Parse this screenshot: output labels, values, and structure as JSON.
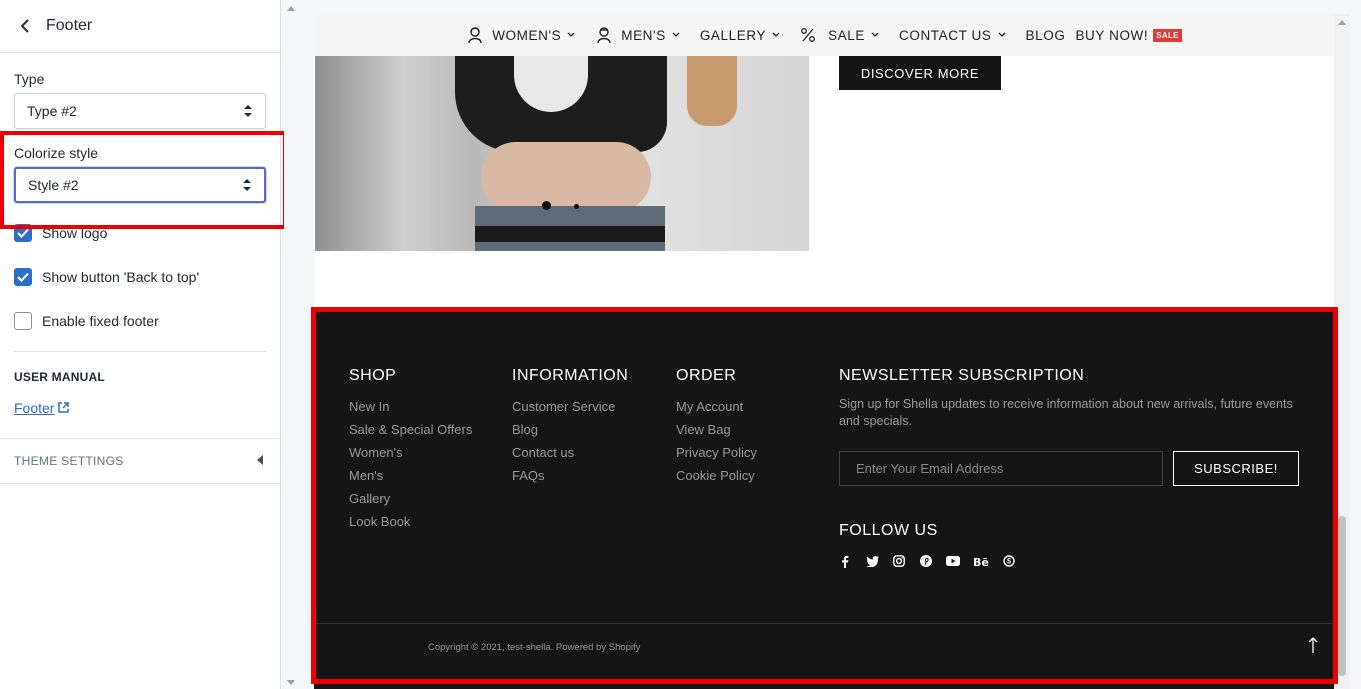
{
  "sidebar": {
    "title": "Footer",
    "type_label": "Type",
    "type_value": "Type #2",
    "colorize_label": "Colorize style",
    "colorize_value": "Style #2",
    "checkboxes": [
      {
        "label": "Show logo",
        "checked": true
      },
      {
        "label": "Show button 'Back to top'",
        "checked": true
      },
      {
        "label": "Enable fixed footer",
        "checked": false
      }
    ],
    "manual_heading": "USER MANUAL",
    "manual_link": "Footer",
    "theme_settings": "THEME SETTINGS"
  },
  "nav": {
    "items": [
      "WOMEN'S",
      "MEN'S",
      "GALLERY",
      "SALE",
      "CONTACT US",
      "BLOG",
      "BUY NOW!"
    ],
    "sale_badge": "SALE"
  },
  "hero": {
    "discover_label": "DISCOVER MORE"
  },
  "footer": {
    "shop": {
      "title": "SHOP",
      "links": [
        "New In",
        "Sale & Special Offers",
        "Women's",
        "Men's",
        "Gallery",
        "Look Book"
      ]
    },
    "information": {
      "title": "INFORMATION",
      "links": [
        "Customer Service",
        "Blog",
        "Contact us",
        "FAQs"
      ]
    },
    "order": {
      "title": "ORDER",
      "links": [
        "My Account",
        "View Bag",
        "Privacy Policy",
        "Cookie Policy"
      ]
    },
    "newsletter": {
      "title": "NEWSLETTER SUBSCRIPTION",
      "text": "Sign up for Shella updates to receive information about new arrivals, future events and specials.",
      "email_placeholder": "Enter Your Email Address",
      "subscribe_label": "SUBSCRIBE!"
    },
    "follow_title": "FOLLOW US",
    "social_icons": [
      "facebook-icon",
      "twitter-icon",
      "instagram-icon",
      "pinterest-icon",
      "youtube-icon",
      "behance-icon",
      "skype-icon"
    ],
    "copyright": "Copyright © 2021, test-shella. Powered by Shopify"
  },
  "colors": {
    "highlight": "#ee0000",
    "footer_bg": "#151515",
    "checkbox": "#2c6ecb"
  }
}
